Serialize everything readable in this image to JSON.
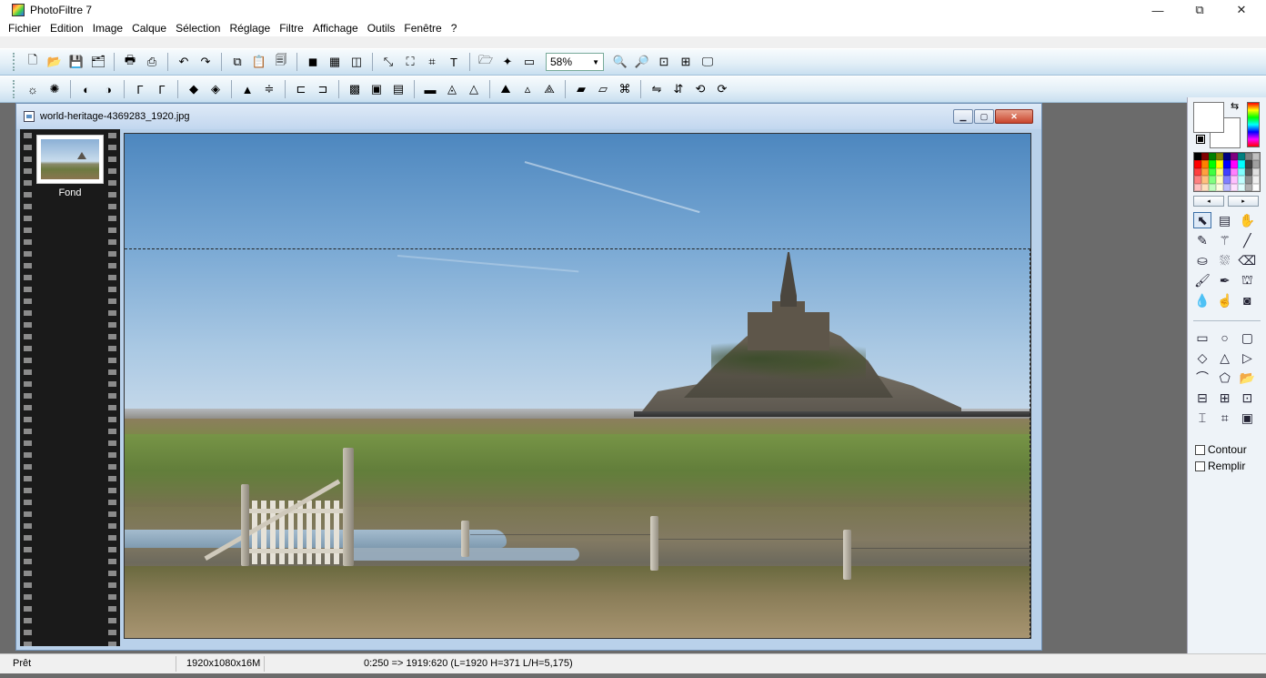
{
  "window": {
    "title": "PhotoFiltre 7",
    "controls": {
      "minimize": "—",
      "maximize": "⧉",
      "close": "✕"
    }
  },
  "menu": [
    "Fichier",
    "Edition",
    "Image",
    "Calque",
    "Sélection",
    "Réglage",
    "Filtre",
    "Affichage",
    "Outils",
    "Fenêtre",
    "?"
  ],
  "toolbar1": {
    "zoom_value": "58%"
  },
  "document": {
    "title": "world-heritage-4369283_1920.jpg",
    "layer_name": "Fond"
  },
  "palette": {
    "swap_icon": "⇆",
    "prev_arrow": "◂",
    "next_arrow": "▸",
    "swatch_colors": [
      "#000000",
      "#800000",
      "#008000",
      "#808000",
      "#000080",
      "#800080",
      "#008080",
      "#808080",
      "#c0c0c0",
      "#ff0000",
      "#ff8000",
      "#00ff00",
      "#ffff00",
      "#0000ff",
      "#ff00ff",
      "#00ffff",
      "#404040",
      "#a0a0a0",
      "#ff4040",
      "#ffa040",
      "#40ff40",
      "#ffff80",
      "#4040ff",
      "#ff80ff",
      "#80ffff",
      "#606060",
      "#e0e0e0",
      "#ff8080",
      "#ffc080",
      "#80ff80",
      "#ffffc0",
      "#8080ff",
      "#ffc0ff",
      "#c0ffff",
      "#909090",
      "#f0f0f0",
      "#ffc0c0",
      "#ffe0c0",
      "#c0ffc0",
      "#ffffe0",
      "#c0c0ff",
      "#ffe0ff",
      "#e0ffff",
      "#b0b0b0",
      "#ffffff"
    ],
    "checkbox_contour": "Contour",
    "checkbox_remplir": "Remplir"
  },
  "status": {
    "ready": "Prêt",
    "dimensions": "1920x1080x16M",
    "coords": "0:250 => 1919:620 (L=1920  H=371  L/H=5,175)"
  }
}
